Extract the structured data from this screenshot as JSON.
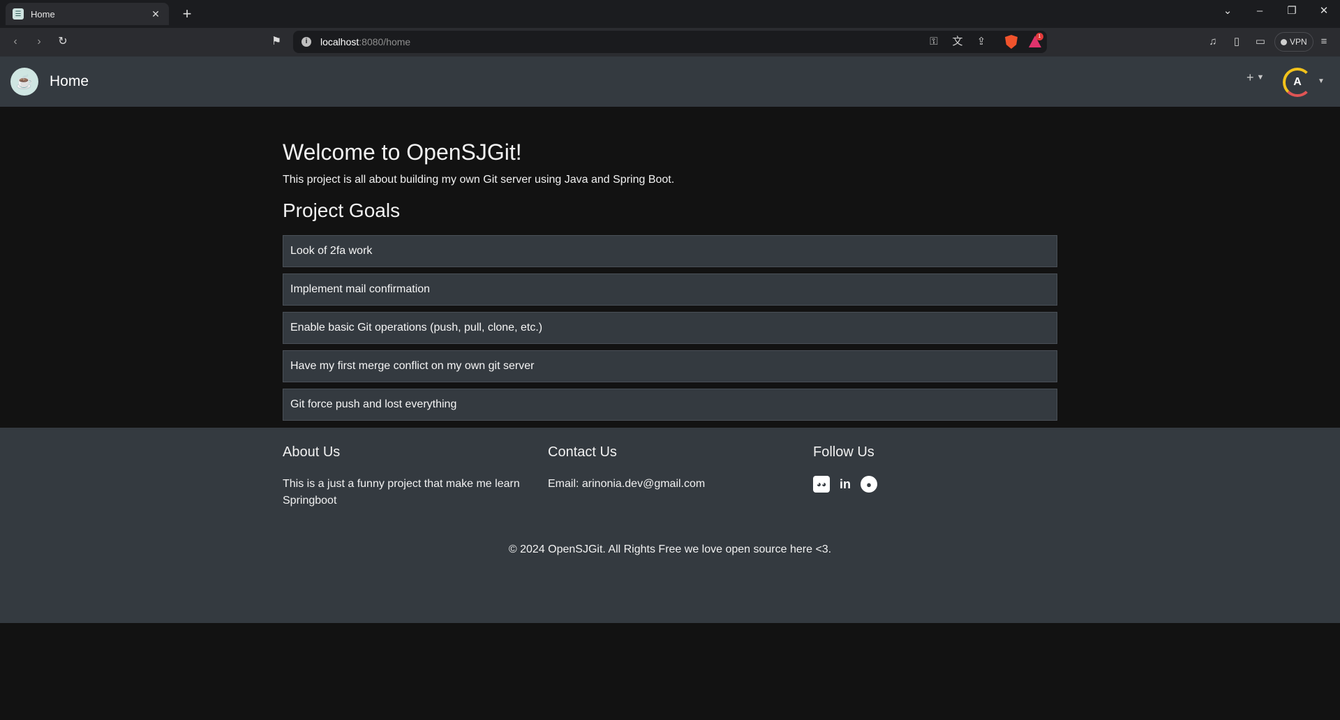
{
  "browser": {
    "tab_title": "Home",
    "tab_close": "✕",
    "new_tab": "+",
    "url_host": "localhost",
    "url_rest": ":8080/home",
    "vpn_label": "VPN",
    "rewards_count": "1"
  },
  "header": {
    "brand": "Home",
    "plus_label": "+",
    "avatar_initial": "A"
  },
  "main": {
    "welcome_title": "Welcome to OpenSJGit!",
    "lead": "This project is all about building my own Git server using Java and Spring Boot.",
    "goals_title": "Project Goals",
    "goals": [
      "Look of 2fa work",
      "Implement mail confirmation",
      "Enable basic Git operations (push, pull, clone, etc.)",
      "Have my first merge conflict on my own git server",
      "Git force push and lost everything"
    ]
  },
  "footer": {
    "about_title": "About Us",
    "about_text": "This is a just a funny project that make me learn Springboot",
    "contact_title": "Contact Us",
    "contact_text": "Email: arinonia.dev@gmail.com",
    "follow_title": "Follow Us",
    "social_icons": [
      "discord-icon",
      "linkedin-icon",
      "github-icon"
    ],
    "copyright": "© 2024 OpenSJGit. All Rights Free we love open source here <3."
  },
  "colors": {
    "page_bg": "#121212",
    "header_bg": "#343a40",
    "card_bg": "#343a40",
    "avatar_ring_top": "#f2c21b",
    "avatar_ring_bottom": "#e05555"
  }
}
